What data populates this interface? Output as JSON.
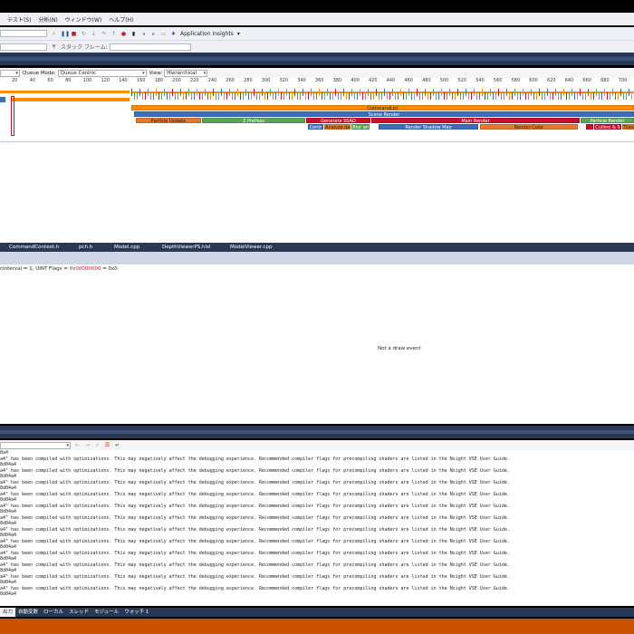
{
  "menu": {
    "items": [
      "テスト(S)",
      "分析(N)",
      "ウィンドウ(W)",
      "ヘルプ(H)"
    ]
  },
  "toolbar": {
    "combo1": "",
    "application_insights": "Application Insights",
    "stack_frame_label": "スタック フレーム:"
  },
  "event_controls": {
    "queue_mode_label": "Queue Mode:",
    "queue_mode_value": "Queue Centric",
    "view_label": "View:",
    "view_value": "Hierarchical"
  },
  "ruler": {
    "ticks": [
      "20",
      "40",
      "60",
      "80",
      "100",
      "120",
      "140",
      "160",
      "180",
      "200",
      "220",
      "240",
      "260",
      "280",
      "300",
      "320",
      "340",
      "360",
      "380",
      "400",
      "420",
      "440",
      "460",
      "480",
      "500",
      "520",
      "540",
      "560",
      "580",
      "600",
      "620",
      "640",
      "660",
      "680",
      "700"
    ]
  },
  "timeline": {
    "commandlist": "CommandList",
    "scene_render": "Scene Render",
    "particle_update": "Particle Update",
    "z_prepass": "Z PrePass",
    "generate_ssao": "Generate SSAO",
    "main_render": "Main Render",
    "particle_render": "Particle Render",
    "centre": "Centr",
    "analyze_depth": "Analyze de",
    "blur_ao": "Blur an",
    "render_shadow_map": "Render Shadow Map",
    "render_color": "Render Color",
    "culling": "Culling & S",
    "tiled": "Tiled"
  },
  "file_tabs": [
    "CommandContext.h",
    "pch.h",
    "Model.cpp",
    "DepthViewerPS.hlsl",
    "ModelViewer.cpp"
  ],
  "info_line": {
    "text": "cInterval = 1, UINT Flags = ",
    "flags_value": "0x00000000",
    "suffix": " = 0x0"
  },
  "detail": {
    "not_draw_event": "Not a draw event"
  },
  "output": {
    "lines": [
      "8a4",
      "a4\" has been compiled with optimizations. This may negatively affect the debugging experience. Recommended compiler flags for precompiling shaders are listed in the Nsight VSE User Guide.",
      "8d04a4",
      "a4\" has been compiled with optimizations. This may negatively affect the debugging experience. Recommended compiler flags for precompiling shaders are listed in the Nsight VSE User Guide.",
      "8d04a4",
      "a4\" has been compiled with optimizations. This may negatively affect the debugging experience. Recommended compiler flags for precompiling shaders are listed in the Nsight VSE User Guide.",
      "8d04a4",
      "a4\" has been compiled with optimizations. This may negatively affect the debugging experience. Recommended compiler flags for precompiling shaders are listed in the Nsight VSE User Guide.",
      "8d04a4",
      "a4\" has been compiled with optimizations. This may negatively affect the debugging experience. Recommended compiler flags for precompiling shaders are listed in the Nsight VSE User Guide.",
      "8d04a4",
      "a4\" has been compiled with optimizations. This may negatively affect the debugging experience. Recommended compiler flags for precompiling shaders are listed in the Nsight VSE User Guide.",
      "8d04a4",
      "a4\" has been compiled with optimizations. This may negatively affect the debugging experience. Recommended compiler flags for precompiling shaders are listed in the Nsight VSE User Guide.",
      "8d04a4",
      "a4\" has been compiled with optimizations. This may negatively affect the debugging experience. Recommended compiler flags for precompiling shaders are listed in the Nsight VSE User Guide.",
      "8d04a4",
      "a4\" has been compiled with optimizations. This may negatively affect the debugging experience. Recommended compiler flags for precompiling shaders are listed in the Nsight VSE User Guide.",
      "8d04a4",
      "a4\" has been compiled with optimizations. This may negatively affect the debugging experience. Recommended compiler flags for precompiling shaders are listed in the Nsight VSE User Guide.",
      "8d04a4",
      "a4\" has been compiled with optimizations. This may negatively affect the debugging experience. Recommended compiler flags for precompiling shaders are listed in the Nsight VSE User Guide.",
      "8d04a4",
      "a4\" has been compiled with optimizations. This may negatively affect the debugging experience. Recommended compiler flags for precompiling shaders are listed in the Nsight VSE User Guide.",
      "8d04a4"
    ]
  },
  "bottom_tabs": [
    "出力",
    "自動変数",
    "ローカル",
    "スレッド",
    "モジュール",
    "ウォッチ 1"
  ],
  "colors": {
    "dark_band": "#293955",
    "status_bar": "#ca5100",
    "orange_bar": "#ff8c00",
    "green_bar": "#5aa55a",
    "red_bar": "#c8102e",
    "blue_bar": "#3c6ebe"
  }
}
